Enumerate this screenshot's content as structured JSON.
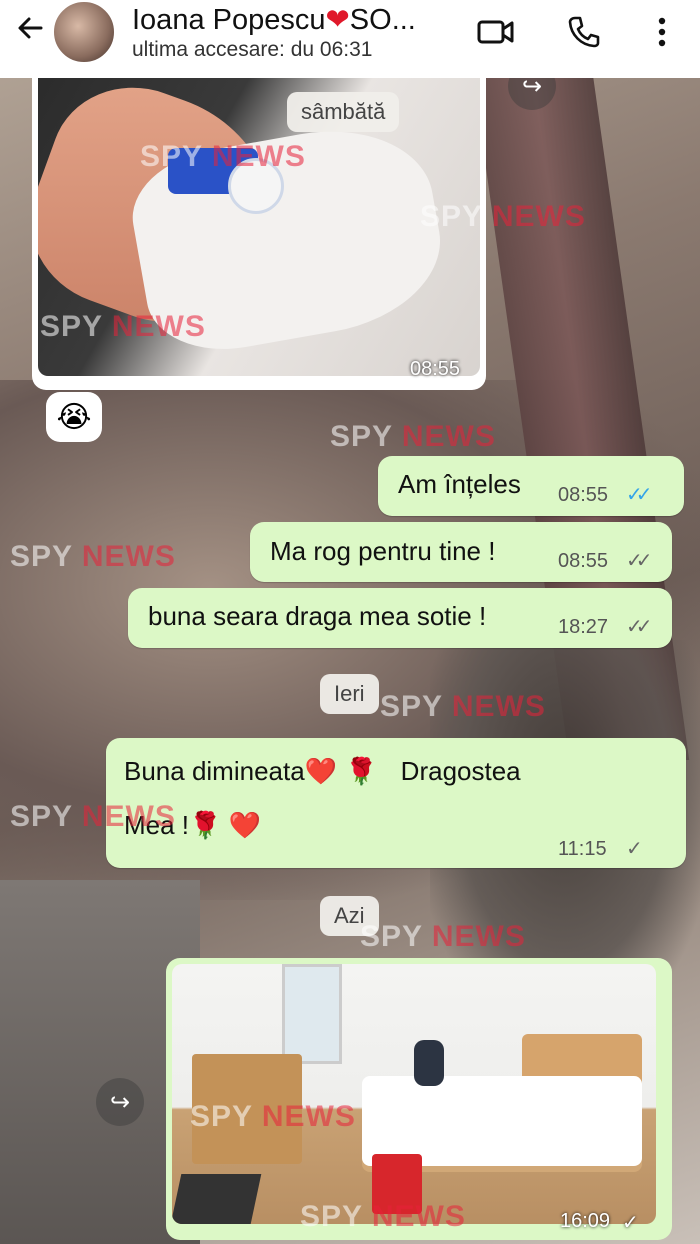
{
  "header": {
    "back_icon": "arrow-left-icon",
    "contact_name": "Ioana Popescu",
    "contact_heart": "❤",
    "contact_suffix": "SO...",
    "last_seen": "ultima accesare: du 06:31",
    "video_icon": "video-camera-icon",
    "call_icon": "phone-icon",
    "more_icon": "more-vertical-icon"
  },
  "chips": {
    "saturday": "sâmbătă",
    "yesterday": "Ieri",
    "today": "Azi"
  },
  "messages": {
    "photo_incoming_time": "08:55",
    "reaction_emoji": "😭",
    "m1_text": "Am înțeles",
    "m1_time": "08:55",
    "m1_ticks": "✓✓",
    "m2_text": "Ma rog pentru tine !",
    "m2_time": "08:55",
    "m2_ticks": "✓✓",
    "m3_text": "buna seara draga mea sotie !",
    "m3_time": "18:27",
    "m3_ticks": "✓✓",
    "m4_line1_a": "Buna dimineata",
    "m4_heart1": "❤️",
    "m4_rose1": "🌹",
    "m4_line1_b": "Dragostea",
    "m4_line2": "Mea !",
    "m4_rose2": "🌹",
    "m4_heart2": "❤️",
    "m4_time": "11:15",
    "m4_tick": "✓",
    "photo_outgoing_time": "16:09",
    "photo_outgoing_tick": "✓"
  },
  "watermark": {
    "spy": "SPY",
    "news": "NEWS"
  },
  "colors": {
    "bubble_outgoing": "#dcf8c6",
    "tick_read": "#34a4e8",
    "watermark_red": "#e8223a"
  }
}
